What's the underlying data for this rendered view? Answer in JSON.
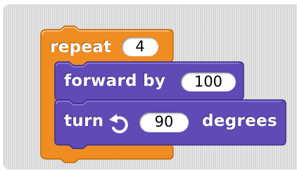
{
  "colors": {
    "control_block": "#ef8d22",
    "motion_block": "#5f4ab6",
    "palette_background": "#d6d6d6"
  },
  "repeat_block": {
    "label": "repeat",
    "count": "4"
  },
  "forward_block": {
    "label": "forward by",
    "steps": "100"
  },
  "turn_block": {
    "label": "turn",
    "icon": "rotate-counterclockwise-icon",
    "degrees_value": "90",
    "degrees_label": "degrees"
  }
}
